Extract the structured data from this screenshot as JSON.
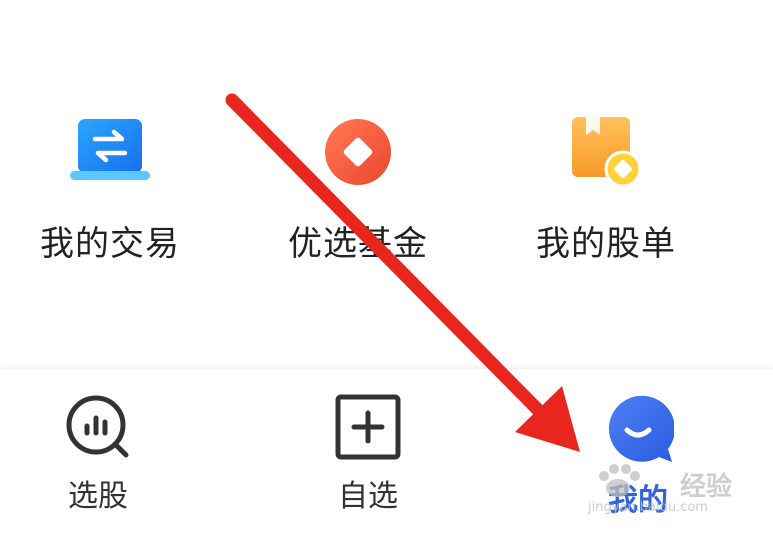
{
  "features": [
    {
      "label": "我的交易",
      "icon": "exchange-icon",
      "color": "#1e88f0"
    },
    {
      "label": "优选基金",
      "icon": "fund-coin-icon",
      "color": "#f05a3c"
    },
    {
      "label": "我的股单",
      "icon": "stock-list-icon",
      "color": "#f7a533"
    }
  ],
  "tabs": [
    {
      "label": "选股",
      "icon": "stock-picker-icon",
      "active": false
    },
    {
      "label": "自选",
      "icon": "add-watchlist-icon",
      "active": false
    },
    {
      "label": "我的",
      "icon": "profile-chat-icon",
      "active": true
    }
  ],
  "colors": {
    "active_tab": "#2f63e0",
    "text_primary": "#222222",
    "annotation_arrow": "#e8261d"
  },
  "watermark": {
    "text": "经验",
    "url": "jingyan.baidu.com"
  }
}
